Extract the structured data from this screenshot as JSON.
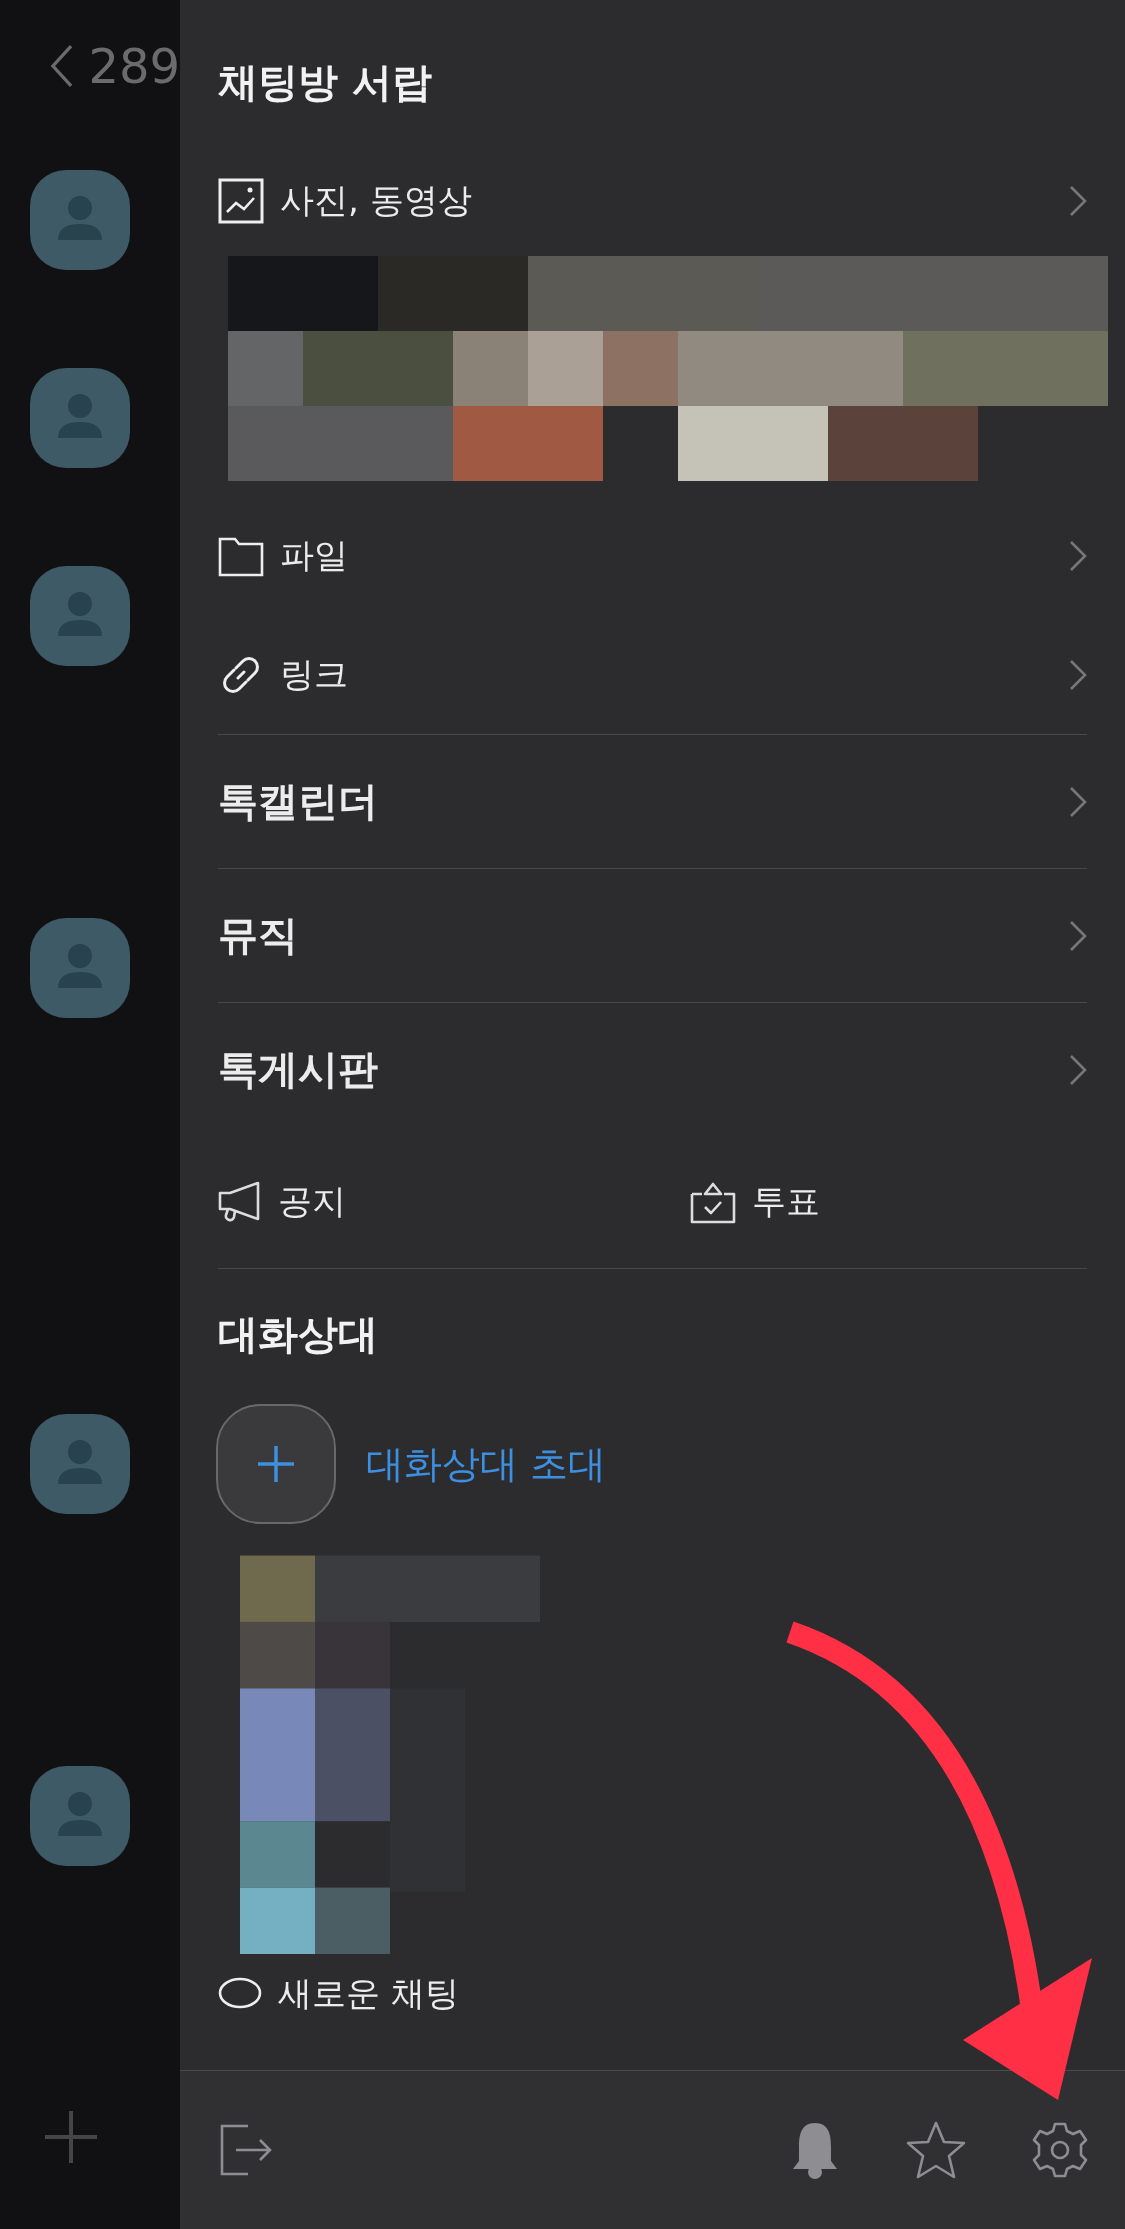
{
  "background": {
    "title": "289"
  },
  "drawer": {
    "title": "채팅방 서랍",
    "menu_items": [
      {
        "kind": "media",
        "label": "사진, 동영상"
      },
      {
        "kind": "folder",
        "label": "파일"
      },
      {
        "kind": "link",
        "label": "링크"
      },
      {
        "kind": "large",
        "label": "톡캘린더"
      },
      {
        "kind": "large",
        "label": "뮤직"
      },
      {
        "kind": "large",
        "label": "톡게시판"
      }
    ],
    "shortcuts": [
      {
        "label": "공지"
      },
      {
        "label": "투표"
      }
    ],
    "members": {
      "title": "대화상대",
      "invite_label": "대화상대 초대"
    },
    "new_chat": {
      "label": "새로운 채팅"
    }
  }
}
